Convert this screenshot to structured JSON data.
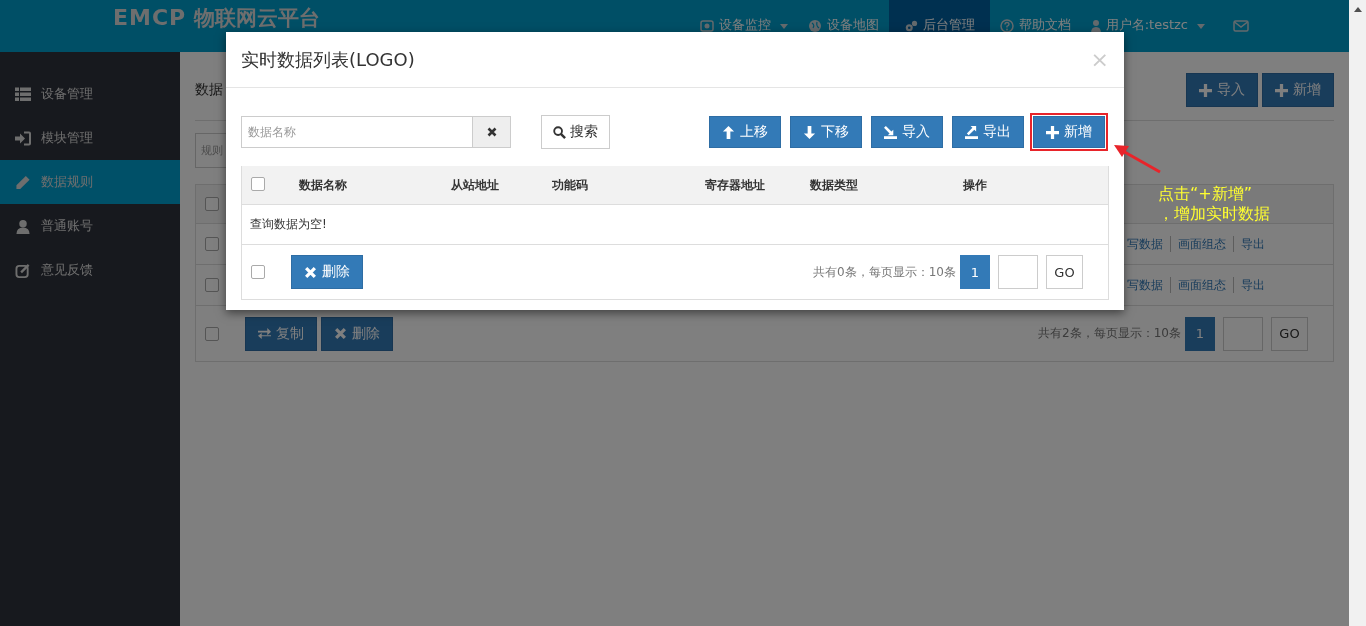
{
  "navbar": {
    "logo": "EMCP",
    "brand": "物联网云平台",
    "items": [
      {
        "label": "设备监控",
        "selected": false,
        "dropdown": true
      },
      {
        "label": "设备地图",
        "selected": false,
        "dropdown": false
      },
      {
        "label": "后台管理",
        "selected": true,
        "dropdown": false
      },
      {
        "label": "帮助文档",
        "selected": false,
        "dropdown": false
      },
      {
        "label": "用户名:testzc",
        "selected": false,
        "dropdown": true
      }
    ]
  },
  "sidebar": {
    "items": [
      {
        "label": "设备管理",
        "selected": false
      },
      {
        "label": "模块管理",
        "selected": false
      },
      {
        "label": "数据规则",
        "selected": true
      },
      {
        "label": "普通账号",
        "selected": false
      },
      {
        "label": "意见反馈",
        "selected": false
      }
    ]
  },
  "page": {
    "title": "数据",
    "header_buttons": [
      "导入",
      "新增"
    ],
    "filter": {
      "placeholder": "规则"
    },
    "table": {
      "header_checked": false,
      "rows": [
        {
          "checked": false,
          "actions": [
            "写数据",
            "画面组态",
            "导出"
          ]
        },
        {
          "checked": false,
          "actions": [
            "写数据",
            "画面组态",
            "导出"
          ]
        }
      ],
      "footer_checked": false,
      "footer_buttons": [
        "复制",
        "删除"
      ],
      "summary": "共有2条，每页显示：10条",
      "page": "1",
      "go": "GO"
    }
  },
  "modal": {
    "title": "实时数据列表(LOGO)",
    "close": "×",
    "search": {
      "placeholder": "数据名称"
    },
    "search_button": "搜索",
    "toolbar": [
      {
        "kind": "up",
        "label": "上移",
        "highlighted": false
      },
      {
        "kind": "down",
        "label": "下移",
        "highlighted": false
      },
      {
        "kind": "import",
        "label": "导入",
        "highlighted": false
      },
      {
        "kind": "export",
        "label": "导出",
        "highlighted": false
      },
      {
        "kind": "add",
        "label": "新增",
        "highlighted": true
      }
    ],
    "table": {
      "select_all_checked": false,
      "columns": [
        "数据名称",
        "从站地址",
        "功能码",
        "寄存器地址",
        "数据类型",
        "操作"
      ],
      "empty_message": "查询数据为空!"
    },
    "footer": {
      "checked": false,
      "delete_button": "删除",
      "summary": "共有0条，每页显示：10条",
      "page": "1",
      "go": "GO"
    }
  },
  "annotation": {
    "lines": [
      "点击“+新增”",
      "，增加实时数据"
    ]
  }
}
